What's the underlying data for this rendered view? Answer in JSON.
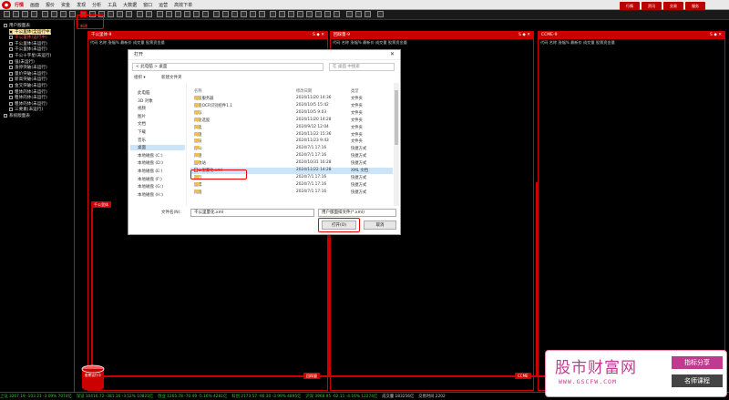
{
  "menubar": {
    "items": [
      "行情",
      "画面",
      "报价",
      "资金",
      "发现",
      "分析",
      "工具",
      "大数据",
      "窗口",
      "运营",
      "高效下单"
    ],
    "active": "行情"
  },
  "toolbar": {
    "hint_label": "新建"
  },
  "top_right": {
    "buttons": [
      "行情",
      "资讯",
      "交易",
      "服务"
    ]
  },
  "sidebar": {
    "items": [
      {
        "label": "用户版面表",
        "type": "header"
      },
      {
        "label": "千公里体(全运行中)",
        "type": "selected"
      },
      {
        "label": "千公里体(运行中)",
        "type": "red"
      },
      {
        "label": "千公里体(未运行)"
      },
      {
        "label": "千公里体(未运行)"
      },
      {
        "label": "千公十字星(未运行)"
      },
      {
        "label": "强(未运行)"
      },
      {
        "label": "涨停突破(未运行)"
      },
      {
        "label": "量价突破(未运行)"
      },
      {
        "label": "新高突破(未运行)"
      },
      {
        "label": "金叉突破(未运行)"
      },
      {
        "label": "粗体的体(未运行)"
      },
      {
        "label": "粗体的体(未运行)"
      },
      {
        "label": "粗体的体(未运行)"
      },
      {
        "label": "三要素(未运行)"
      },
      {
        "label": "系统版面表",
        "type": "header"
      }
    ]
  },
  "panels": [
    {
      "title": "千公里体-9",
      "cols": "代码 名称 涨幅% 最新价 成交量 股票资金量"
    },
    {
      "title": "回踩量-9",
      "cols": "代码 名称 涨幅% 最新价 成交量 股票资金量"
    },
    {
      "title": "CCME-9",
      "cols": "代码 名称 涨幅% 最新价 成交量 股票资金量"
    }
  ],
  "flow_tags": {
    "left": "千公里体",
    "bottom_mid": "回踩量",
    "bottom_right": "CCME",
    "db": "股票运行中"
  },
  "dialog": {
    "title": "打开",
    "close": "✕",
    "address": "< 此电脑 > 桌面",
    "search_placeholder": "在 桌面 中搜索",
    "organize": "组织 ▾",
    "new_folder": "新建文件夹",
    "nav": [
      "此电脑",
      "3D 对象",
      "视频",
      "图片",
      "文档",
      "下载",
      "音乐",
      "桌面",
      "本地磁盘 (C:)",
      "本地磁盘 (D:)",
      "本地磁盘 (E:)",
      "本地磁盘 (F:)",
      "本地磁盘 (G:)",
      "本地磁盘 (H:)"
    ],
    "nav_selected": "桌面",
    "headers": [
      "名称",
      "修改日期",
      "类型"
    ],
    "files": [
      {
        "name": "选股服务器",
        "date": "2024/11/20 14:36",
        "type": "文件夹",
        "icon": "folder"
      },
      {
        "name": "量能OCR识别组件1.1",
        "date": "2024/10/5 15:42",
        "type": "文件夹",
        "icon": "folder"
      },
      {
        "name": "指标",
        "date": "2024/10/5 9:03",
        "type": "文件夹",
        "icon": "folder"
      },
      {
        "name": "资金选股",
        "date": "2024/11/20 14:28",
        "type": "文件夹",
        "icon": "folder"
      },
      {
        "name": "买卖",
        "date": "2024/9/12 12:04",
        "type": "文件夹",
        "icon": "folder"
      },
      {
        "name": "网盘",
        "date": "2024/11/22 15:36",
        "type": "文件夹",
        "icon": "folder"
      },
      {
        "name": "股份",
        "date": "2024/11/23 9:43",
        "type": "文件夹",
        "icon": "folder"
      },
      {
        "name": "办公",
        "date": "2024/7/1 17:16",
        "type": "快捷方式",
        "icon": "folder"
      },
      {
        "name": "开盘",
        "date": "2024/7/1 17:16",
        "type": "快捷方式",
        "icon": "folder"
      },
      {
        "name": "回收站",
        "date": "2024/10/31 16:28",
        "type": "快捷方式",
        "icon": "folder"
      },
      {
        "name": "千公里量化.xml",
        "date": "2024/11/22 14:28",
        "type": "XML 文档",
        "icon": "file",
        "selected": true
      },
      {
        "name": "新行",
        "date": "2024/7/1 17:16",
        "type": "快捷方式",
        "icon": "folder"
      },
      {
        "name": "股票",
        "date": "2024/7/1 17:16",
        "type": "快捷方式",
        "icon": "folder"
      },
      {
        "name": "桌面",
        "date": "2024/7/1 17:16",
        "type": "快捷方式",
        "icon": "folder"
      }
    ],
    "filename_label": "文件名(N):",
    "filename_value": "千公里量化.xml",
    "filter_value": "用户版面排文件(*.xml)",
    "open_label": "打开(O)",
    "cancel_label": "取消"
  },
  "statusbar": [
    {
      "text": "上证 3267.19 -103.21 -3.09% 7074亿",
      "cls": "dn"
    },
    {
      "text": "深证 10416.72 -381.16 -3.52% 10821亿",
      "cls": "dn"
    },
    {
      "text": "创业 1265.78 -70.49 -5.16% 4281亿",
      "cls": "dn"
    },
    {
      "text": "科创 2173.57 -90.30 -3.99% 4895亿",
      "cls": "dn"
    },
    {
      "text": "沪深 3968.95 -62.11 -4.16% 12274亿",
      "cls": "dn"
    },
    {
      "text": "成交量 183256亿",
      "cls": ""
    },
    {
      "text": "交易时间 2202",
      "cls": ""
    }
  ],
  "watermark": {
    "title": "股市财富网",
    "url": "WWW.GSCFW.COM",
    "tag1": "指标分享",
    "tag2": "名师课程"
  },
  "colors": {
    "accent": "#cc0000",
    "watermark": "#c03a8f",
    "selection": "#cce4f7"
  }
}
